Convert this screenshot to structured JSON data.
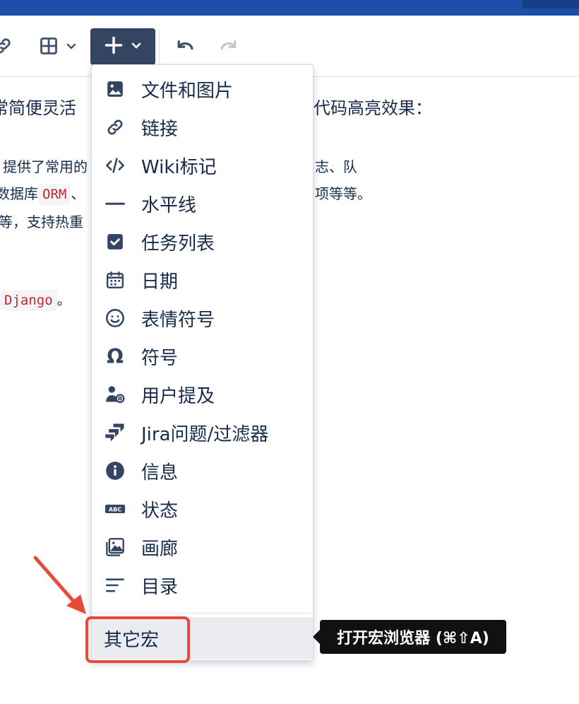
{
  "toolbar": {
    "link_icon": "link-icon",
    "table_icon": "table-icon",
    "insert_icon": "plus-icon",
    "undo_icon": "undo-icon",
    "redo_icon": "redo-icon"
  },
  "content": {
    "line1_left": "常简便灵活",
    "line1_right": "代码高亮效果：",
    "line2_left": "提供了常用的",
    "line2_right": "志、队",
    "line3_left": "数据库",
    "line3_code": "ORM",
    "line3_sep": "、",
    "line3_right": "项等等。",
    "line4_left": "等，支持热重",
    "line5_code": "Django",
    "line5_tail": "。"
  },
  "menu": {
    "items": [
      {
        "label": "文件和图片",
        "icon": "image-icon"
      },
      {
        "label": "链接",
        "icon": "link-icon"
      },
      {
        "label": "Wiki标记",
        "icon": "code-icon"
      },
      {
        "label": "水平线",
        "icon": "horizontal-rule-icon"
      },
      {
        "label": "任务列表",
        "icon": "checkbox-icon"
      },
      {
        "label": "日期",
        "icon": "calendar-icon"
      },
      {
        "label": "表情符号",
        "icon": "emoji-icon"
      },
      {
        "label": "符号",
        "icon": "omega-icon"
      },
      {
        "label": "用户提及",
        "icon": "mention-icon"
      },
      {
        "label": "Jira问题/过滤器",
        "icon": "jira-icon"
      },
      {
        "label": "信息",
        "icon": "info-icon"
      },
      {
        "label": "状态",
        "icon": "status-icon"
      },
      {
        "label": "画廊",
        "icon": "gallery-icon"
      },
      {
        "label": "目录",
        "icon": "toc-icon"
      }
    ],
    "more_label": "其它宏"
  },
  "tooltip": {
    "text": "打开宏浏览器 (⌘⇧A)"
  },
  "colors": {
    "topbar": "#1b4fa9",
    "insert_button": "#344563",
    "annotation": "#e8493a",
    "code_text": "#c1272d"
  }
}
